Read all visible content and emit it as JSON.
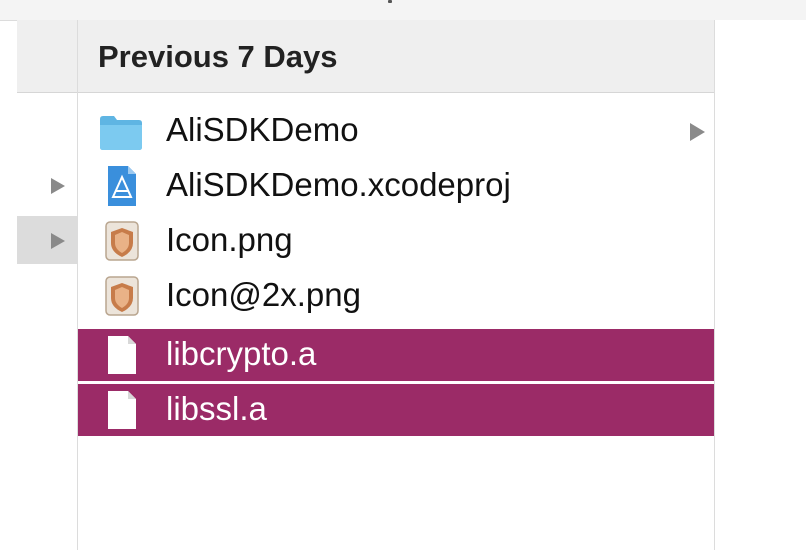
{
  "header": {
    "title": "Previous 7 Days"
  },
  "files": [
    {
      "name": "AliSDKDemo",
      "icon": "folder-icon",
      "selected": false,
      "has_children": true
    },
    {
      "name": "AliSDKDemo.xcodeproj",
      "icon": "xcodeproj-icon",
      "selected": false,
      "has_children": false
    },
    {
      "name": "Icon.png",
      "icon": "png-image-icon",
      "selected": false,
      "has_children": false
    },
    {
      "name": "Icon@2x.png",
      "icon": "png-image-icon",
      "selected": false,
      "has_children": false
    },
    {
      "name": "libcrypto.a",
      "icon": "document-icon",
      "selected": true,
      "has_children": false
    },
    {
      "name": "libssl.a",
      "icon": "document-icon",
      "selected": true,
      "has_children": false
    }
  ],
  "colors": {
    "selection": "#9b2b67",
    "folder": "#6bbde8",
    "header_bg": "#efefef"
  }
}
